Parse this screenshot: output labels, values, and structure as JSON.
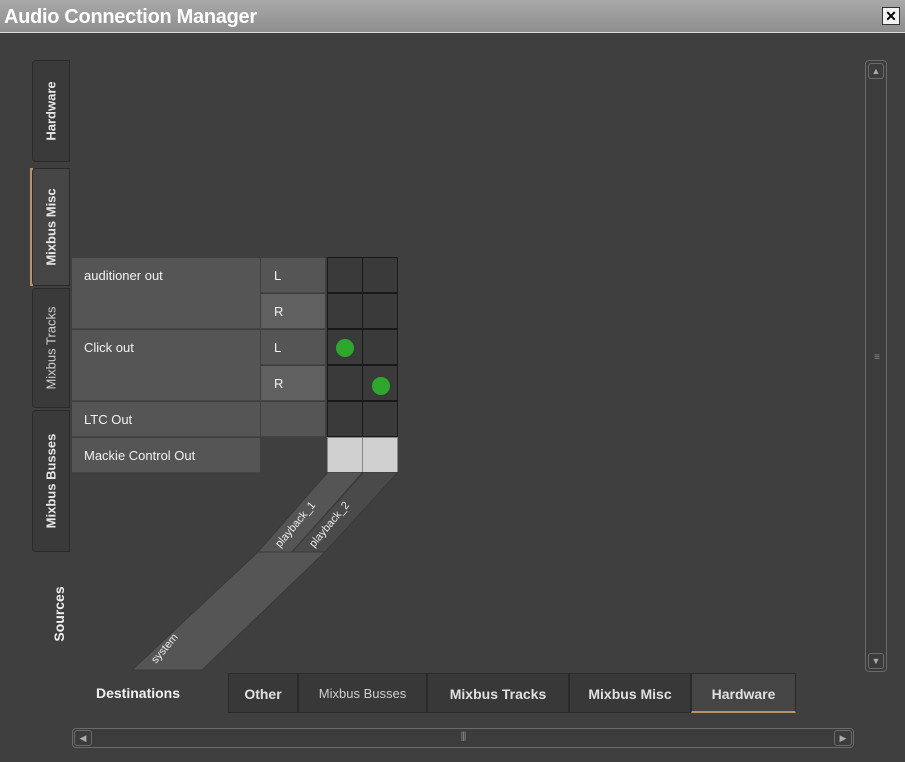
{
  "window": {
    "title": "Audio Connection Manager",
    "close_glyph": "✕"
  },
  "sources": {
    "label": "Sources",
    "tabs": [
      {
        "label": "Hardware"
      },
      {
        "label": "Mixbus Misc",
        "active": true
      },
      {
        "label": "Mixbus Tracks"
      },
      {
        "label": "Mixbus Busses"
      }
    ]
  },
  "rows": [
    {
      "name": "auditioner out",
      "channels": [
        "L",
        "R"
      ]
    },
    {
      "name": "Click out",
      "channels": [
        "L",
        "R"
      ]
    },
    {
      "name": "LTC Out",
      "channels": [
        ""
      ]
    },
    {
      "name": "Mackie Control Out",
      "channels": []
    }
  ],
  "columns": {
    "group": "system",
    "ports": [
      "playback_1",
      "playback_2"
    ]
  },
  "connections": [
    {
      "row": "Click out L",
      "column": "playback_1",
      "connected": true
    },
    {
      "row": "Click out R",
      "column": "playback_2",
      "connected": true
    }
  ],
  "destinations": {
    "label": "Destinations",
    "tabs": [
      {
        "label": "Other"
      },
      {
        "label": "Mixbus Busses"
      },
      {
        "label": "Mixbus Tracks"
      },
      {
        "label": "Mixbus Misc"
      },
      {
        "label": "Hardware",
        "active": true
      }
    ]
  },
  "colors": {
    "connected": "#2ca82c",
    "accent": "#b8946a"
  }
}
